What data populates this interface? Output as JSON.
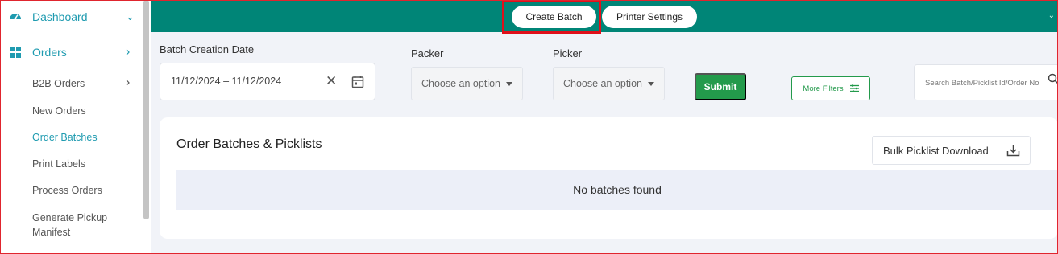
{
  "sidebar": {
    "dashboard": "Dashboard",
    "orders": "Orders",
    "sub_items": [
      {
        "label": "B2B Orders"
      },
      {
        "label": "New Orders"
      },
      {
        "label": "Order Batches"
      },
      {
        "label": "Print Labels"
      },
      {
        "label": "Process Orders"
      },
      {
        "label": "Generate Pickup"
      },
      {
        "label": "Manifest"
      }
    ],
    "accent_color": "#1f9bb0"
  },
  "topbar": {
    "create_batch": "Create Batch",
    "printer_settings": "Printer Settings",
    "color": "#008577"
  },
  "filters": {
    "batch_date_label": "Batch Creation Date",
    "date_range": "11/12/2024 – 11/12/2024",
    "packer_label": "Packer",
    "packer_placeholder": "Choose an option",
    "picker_label": "Picker",
    "picker_placeholder": "Choose an option",
    "submit": "Submit",
    "more_filters": "More Filters",
    "search_placeholder": "Search Batch/Picklist Id/Order No"
  },
  "main": {
    "title": "Order Batches & Picklists",
    "bulk_download": "Bulk Picklist Download",
    "empty_message": "No batches found"
  },
  "colors": {
    "submit": "#239a4b",
    "highlight": "#e0101b"
  }
}
